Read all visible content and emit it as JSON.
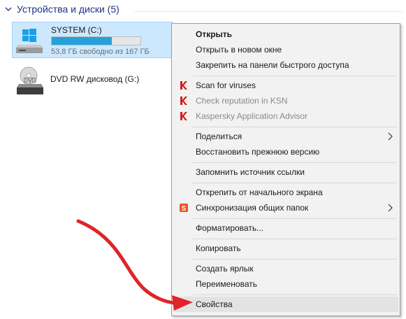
{
  "group": {
    "title": "Устройства и диски (5)"
  },
  "drives": [
    {
      "name": "SYSTEM (C:)",
      "free_text": "53,8 ГБ свободно из 167 ГБ",
      "used_fraction": 0.678
    },
    {
      "name": "DVD RW дисковод (G:)",
      "icon_label": "DVD"
    }
  ],
  "menu": {
    "open": "Открыть",
    "open_new_window": "Открыть в новом окне",
    "pin_quick_access": "Закрепить на панели быстрого доступа",
    "scan_viruses": "Scan for viruses",
    "check_ksn": "Check reputation in KSN",
    "kaspersky_advisor": "Kaspersky Application Advisor",
    "share": "Поделиться",
    "restore_previous": "Восстановить прежнюю версию",
    "remember_link": "Запомнить источник ссылки",
    "unpin_start": "Открепить от начального экрана",
    "sync_shared": "Синхронизация общих папок",
    "format": "Форматировать...",
    "copy": "Копировать",
    "create_shortcut": "Создать ярлык",
    "rename": "Переименовать",
    "properties": "Свойства"
  },
  "colors": {
    "selection_bg": "#cce8ff",
    "capacity_fill": "#26a0da",
    "kaspersky_red": "#d7191c",
    "arrow_red": "#e0242a",
    "header_text": "#1e3287"
  }
}
